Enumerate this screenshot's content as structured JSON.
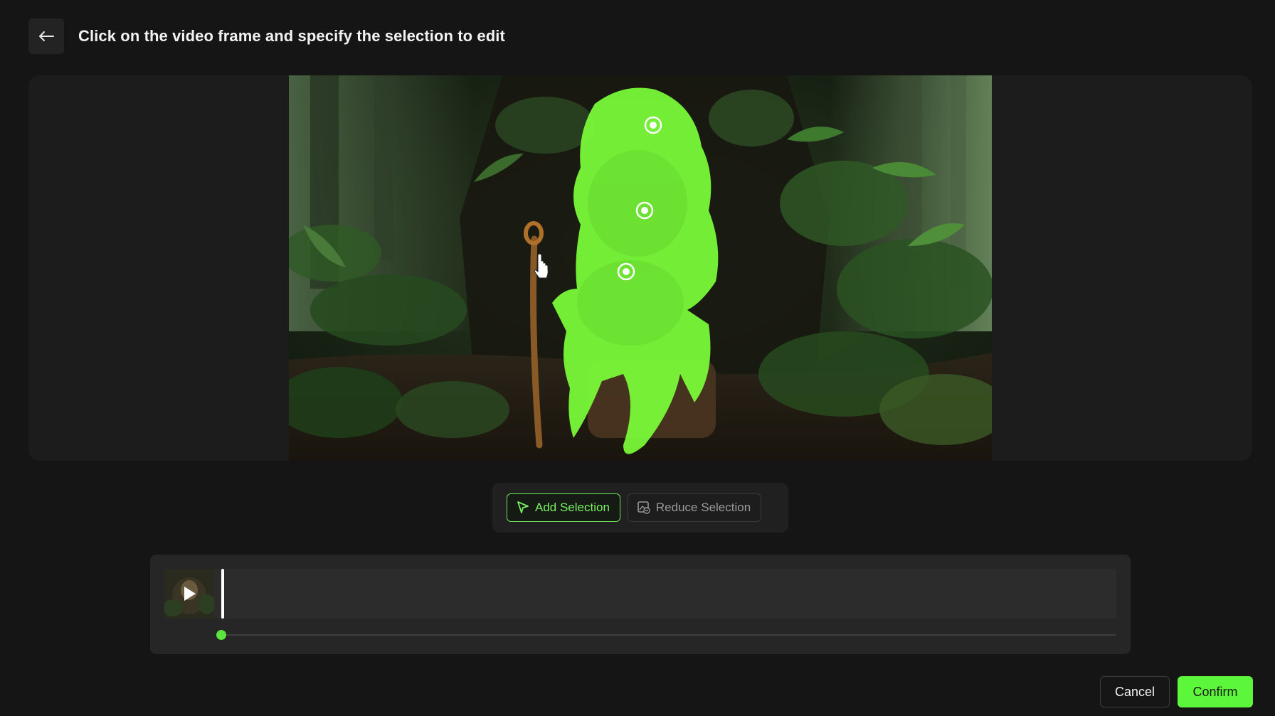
{
  "header": {
    "back_icon": "arrow-left-icon",
    "title": "Click on the video frame and specify the selection to edit"
  },
  "editor": {
    "frame_description_icons": [
      "selection-point-icon",
      "selection-point-icon",
      "selection-point-icon"
    ],
    "cursor_icon": "hand-pointer-icon"
  },
  "toolbar": {
    "add_selection_label": "Add Selection",
    "add_selection_icon": "cursor-arrow-icon",
    "reduce_selection_label": "Reduce Selection",
    "reduce_selection_icon": "image-edit-icon"
  },
  "timeline": {
    "thumbnail_icon": "play-icon",
    "progress": 0
  },
  "footer": {
    "cancel_label": "Cancel",
    "confirm_label": "Confirm"
  },
  "colors": {
    "accent": "#5cf73a",
    "selection_overlay": "#7cff3a",
    "background": "#151515"
  }
}
